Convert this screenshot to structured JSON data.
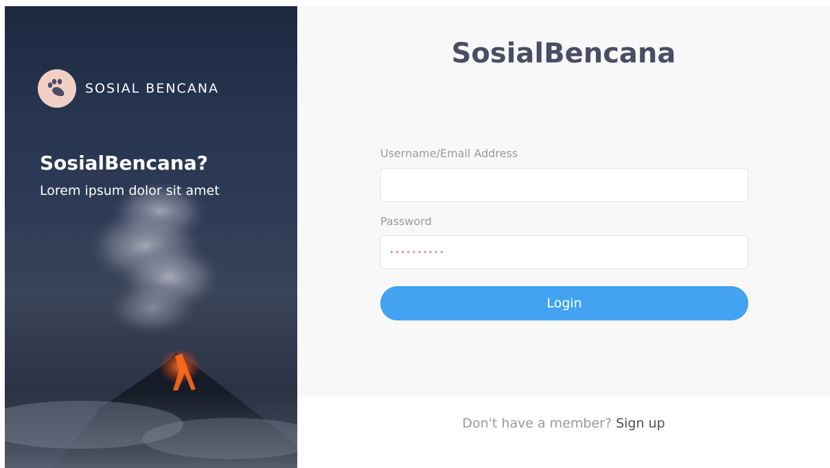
{
  "hero": {
    "brand_name": "SOSIAL BENCANA",
    "brand_logo_icon": "paw-icon",
    "title": "SosialBencana?",
    "subtitle": "Lorem ipsum dolor sit amet"
  },
  "login": {
    "app_title": "SosialBencana",
    "username_label": "Username/Email Address",
    "username_value": "",
    "password_label": "Password",
    "password_value": "••••••••••",
    "login_button": "Login",
    "signup_prompt": "Don't have a member?",
    "signup_link": "Sign up"
  },
  "colors": {
    "accent": "#43a3f2",
    "title": "#4b4d66",
    "logo_bg": "#f2cfc4",
    "card_bg": "#f8f8f8"
  }
}
